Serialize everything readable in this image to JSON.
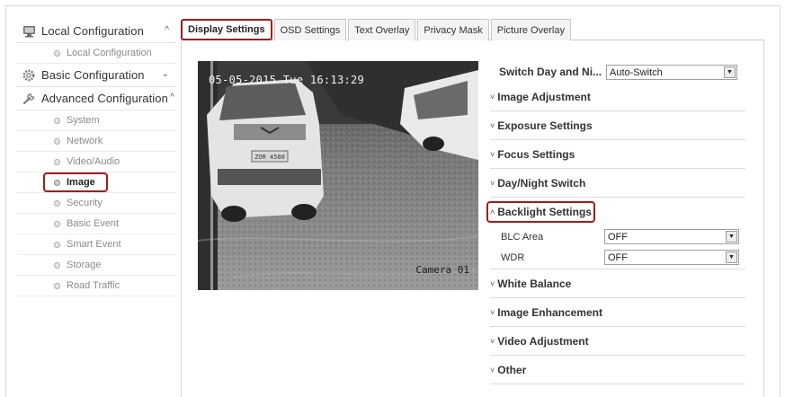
{
  "sidebar": {
    "groups": [
      {
        "label": "Local Configuration",
        "icon": "monitor-icon",
        "expanded": true,
        "items": [
          {
            "label": "Local Configuration"
          }
        ]
      },
      {
        "label": "Basic Configuration",
        "icon": "gear-icon",
        "expanded": false,
        "items": []
      },
      {
        "label": "Advanced Configuration",
        "icon": "wrench-icon",
        "expanded": true,
        "items": [
          {
            "label": "System"
          },
          {
            "label": "Network"
          },
          {
            "label": "Video/Audio"
          },
          {
            "label": "Image",
            "active": true
          },
          {
            "label": "Security"
          },
          {
            "label": "Basic Event"
          },
          {
            "label": "Smart Event"
          },
          {
            "label": "Storage"
          },
          {
            "label": "Road Traffic"
          }
        ]
      }
    ]
  },
  "tabs": [
    "Display Settings",
    "OSD Settings",
    "Text Overlay",
    "Privacy Mask",
    "Picture Overlay"
  ],
  "active_tab": "Display Settings",
  "video": {
    "osd_datetime": "05-05-2015 Tue 16:13:29",
    "osd_camera_name": "Camera 01",
    "plate_text": "ZOR 4580"
  },
  "panel": {
    "switch_day_night": {
      "label": "Switch Day and Ni...",
      "value": "Auto-Switch"
    },
    "sections": {
      "image_adjustment": "Image Adjustment",
      "exposure_settings": "Exposure Settings",
      "focus_settings": "Focus Settings",
      "day_night_switch": "Day/Night Switch",
      "backlight_settings": "Backlight Settings",
      "white_balance": "White Balance",
      "image_enhancement": "Image Enhancement",
      "video_adjustment": "Video Adjustment",
      "other": "Other"
    },
    "backlight": {
      "blc_area": {
        "label": "BLC Area",
        "value": "OFF"
      },
      "wdr": {
        "label": "WDR",
        "value": "OFF"
      }
    }
  },
  "colors": {
    "highlight": "#a31b1b"
  },
  "carets": {
    "collapsed": "˅",
    "expanded": "˄",
    "group_up": "^",
    "group_down": "⌄"
  }
}
